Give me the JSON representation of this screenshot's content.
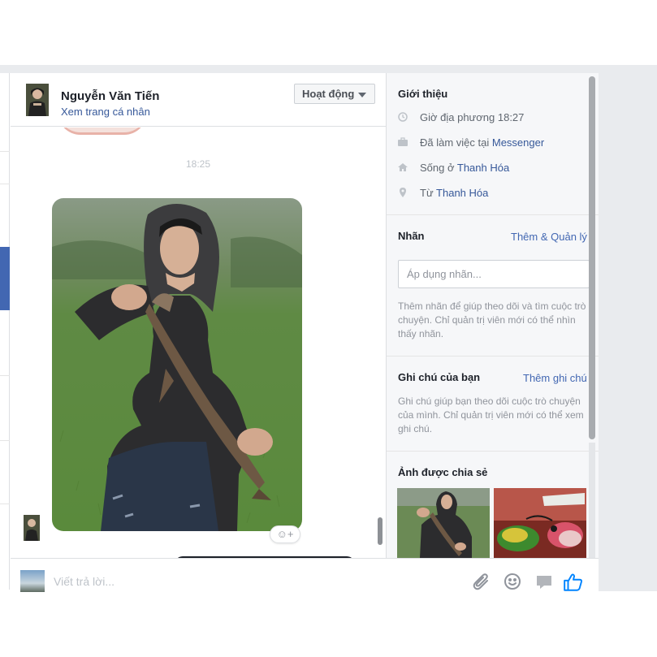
{
  "header": {
    "name": "Nguyễn Văn Tiến",
    "profile_link": "Xem trang cá nhân",
    "status_button": "Hoạt động"
  },
  "chat": {
    "timestamp": "18:25",
    "reaction_icon": "add-reaction-icon"
  },
  "composer": {
    "placeholder": "Viết trả lời...",
    "icons": [
      "paperclip-icon",
      "emoji-icon",
      "sticker-icon",
      "thumbs-up-icon"
    ]
  },
  "info_panel": {
    "intro": {
      "title": "Giới thiệu",
      "local_time": "Giờ địa phương 18:27",
      "work_prefix": "Đã làm việc tại",
      "work_link": "Messenger",
      "lives_prefix": "Sống ở",
      "lives_link": "Thanh Hóa",
      "from_prefix": "Từ",
      "from_link": "Thanh Hóa"
    },
    "labels": {
      "title": "Nhãn",
      "manage_link": "Thêm & Quản lý",
      "input_placeholder": "Áp dụng nhãn...",
      "help": "Thêm nhãn để giúp theo dõi và tìm cuộc trò chuyện. Chỉ quản trị viên mới có thể nhìn thấy nhãn."
    },
    "notes": {
      "title": "Ghi chú của bạn",
      "add_link": "Thêm ghi chú",
      "help": "Ghi chú giúp bạn theo dõi cuộc trò chuyện của mình. Chỉ quản trị viên mới có thể xem ghi chú."
    },
    "shared_photos": {
      "title": "Ảnh được chia sẻ"
    }
  },
  "colors": {
    "link": "#365899",
    "accent": "#4267b2",
    "like": "#0084ff"
  }
}
